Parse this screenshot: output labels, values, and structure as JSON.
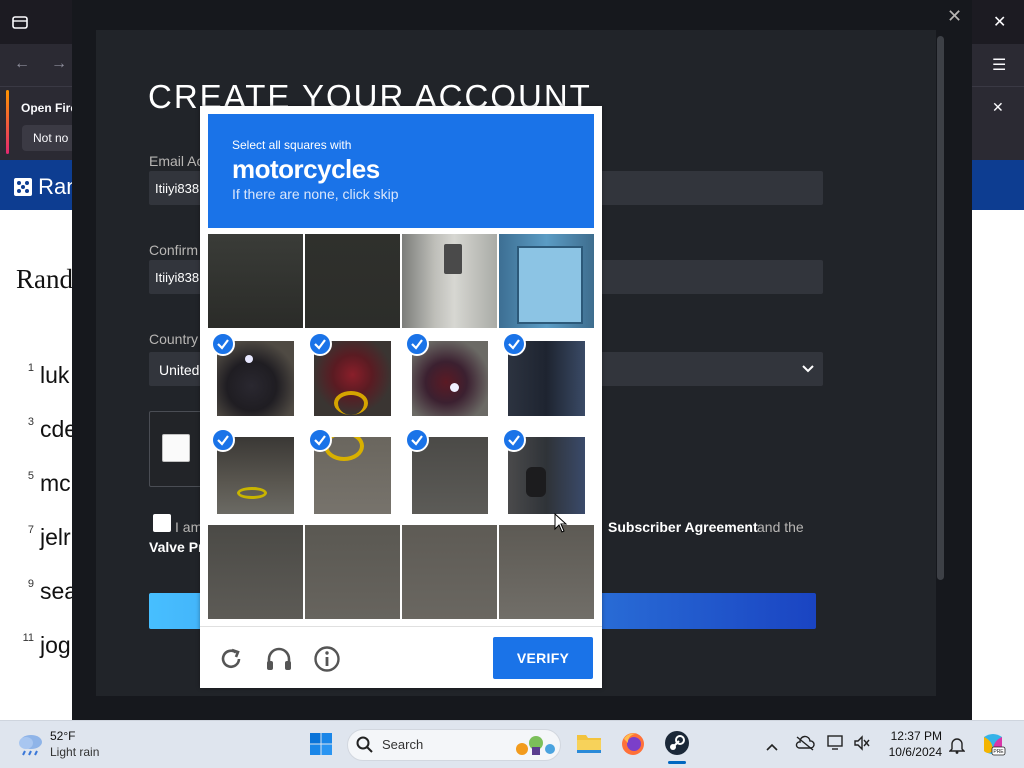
{
  "browser": {
    "notification": {
      "title": "Open Fire",
      "button": "Not no"
    },
    "site_logo_text": "Ran",
    "page_heading": "Rand",
    "word_list": [
      {
        "num": "1",
        "text": "luk"
      },
      {
        "num": "3",
        "text": "cde"
      },
      {
        "num": "5",
        "text": "mc"
      },
      {
        "num": "7",
        "text": "jelr"
      },
      {
        "num": "9",
        "text": "sea"
      },
      {
        "num": "11",
        "text": "jog"
      }
    ]
  },
  "signup": {
    "title": "CREATE YOUR ACCOUNT",
    "email_label": "Email Ac",
    "email_value": "Itiiyi838",
    "confirm_label": "Confirm",
    "confirm_value": "Itiiyi838",
    "country_label": "Country",
    "country_value": "United",
    "agree_text": "I am",
    "agree_link": "Subscriber Agreement",
    "agree_tail": "and the",
    "valve_text": "Valve Pr"
  },
  "captcha": {
    "instruction": "Select all squares with",
    "target": "motorcycles",
    "hint": "If there are none, click skip",
    "verify_label": "VERIFY",
    "tiles_selected": [
      false,
      false,
      false,
      false,
      true,
      true,
      true,
      true,
      true,
      true,
      true,
      true,
      false,
      false,
      false,
      false
    ]
  },
  "taskbar": {
    "temperature": "52°F",
    "weather": "Light rain",
    "search_placeholder": "Search",
    "time": "12:37 PM",
    "date": "10/6/2024"
  },
  "colors": {
    "captcha_blue": "#1a73e8",
    "steam_bg": "#212429",
    "site_header": "#0d3d91"
  }
}
